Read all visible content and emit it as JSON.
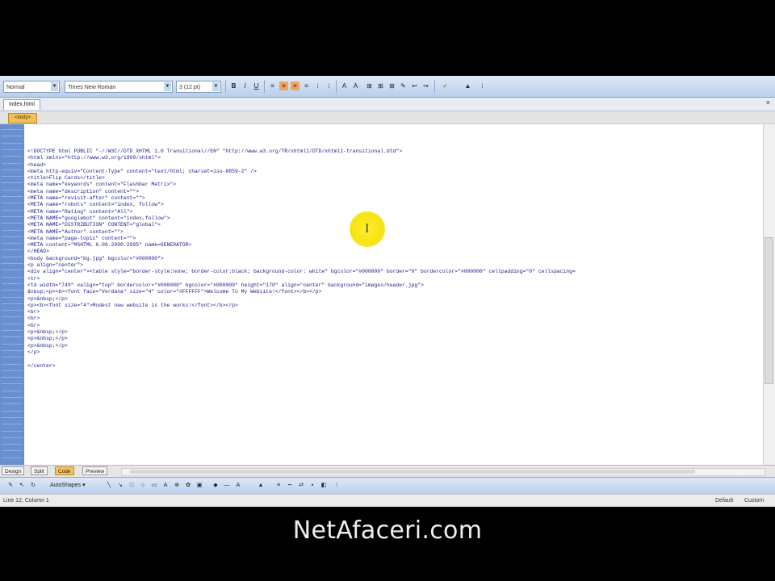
{
  "toolbar": {
    "style_select": "Normal",
    "font_select": "Times New Roman",
    "size_select": "3 (12 pt)",
    "buttons": [
      "B",
      "I",
      "U",
      "≡",
      "≡",
      "≡",
      "≡",
      "⁝",
      "⁝",
      "A",
      "A",
      "⊞",
      "⊞",
      "⊞",
      "✎",
      "↩",
      "↪",
      "✓",
      "▲",
      "⁝"
    ]
  },
  "document": {
    "tab_label": "index.html",
    "close_label": "×",
    "sub_tab_label": "<body>"
  },
  "code_lines": [
    "<!DOCTYPE html PUBLIC \"-//W3C//DTD XHTML 1.0 Transitional//EN\" \"http://www.w3.org/TR/xhtml1/DTD/xhtml1-transitional.dtd\">",
    "<html xmlns=\"http://www.w3.org/1999/xhtml\">",
    "<head>",
    "<meta http-equiv=\"Content-Type\" content=\"text/html; charset=iso-8859-2\" />",
    "<title>Flip Cards</title>",
    "<meta name=\"keywords\" content=\"Flashbar Metrix\">",
    "<meta name=\"description\" content=\"\">",
    "<META name=\"revisit-after\" content=\"\">",
    "<META name=\"robots\" content=\"index, follow\">",
    "<META name=\"Rating\" content=\"All\">",
    "<META NAME=\"googlebot\" content=\"index,follow\">",
    "<META NAME=\"DISTRIBUTION\" CONTENT=\"global\">",
    "<META NAME=\"Author\" content=\"\">",
    "<meta name=\"page-topic\" content=\"\">",
    "<META content=\"MSHTML 6.00.2900.2995\" name=GENERATOR>",
    "</HEAD>",
    "<body background=\"bg.jpg\" bgcolor=\"#000000\">",
    "<p align=\"center\">",
    "<div align=\"center\"><table style=\"border-style:none; border-color:black; background-color: white\" bgcolor=\"#000000\" border=\"0\" bordercolor=\"#000000\" cellpadding=\"0\" cellspacing=",
    "<tr>",
    "<td width=\"749\" valign=\"top\" bordercolor=\"#000000\" bgcolor=\"#000000\" height=\"170\" align=\"center\" background=\"images/header.jpg\">",
    "&nbsp;<p><b><font face=\"Verdana\" size=\"4\" color=\"#FFFFFF\">Welcome To My Website!</font></b></p>",
    "<p>&nbsp;</p>",
    "<p><b><font size=\"4\">Modest new website is the works!</font></b></p>",
    "<br>",
    "<br>",
    "<br>",
    "<p>&nbsp;</p>",
    "<p>&nbsp;</p>",
    "<p>&nbsp;</p>",
    "</p>",
    "",
    "</center>"
  ],
  "view_tabs": [
    "Design",
    "Split",
    "Code",
    "Preview"
  ],
  "active_view": "Code",
  "bottom_toolbar": {
    "autoshapes_label": "AutoShapes ▾"
  },
  "status": {
    "left": "Line 12, Column 1",
    "right_1": "Default",
    "right_2": "Custom"
  },
  "watermark": "NetAfaceri.com",
  "colors": {
    "toolbar_top": "#dfe9f7",
    "toolbar_bottom": "#b9cfeb",
    "gutter": "#6a8fd0",
    "code_text": "#1a1a8c",
    "active_tab": "#f7c25a",
    "cursor_highlight": "#f6e312"
  }
}
